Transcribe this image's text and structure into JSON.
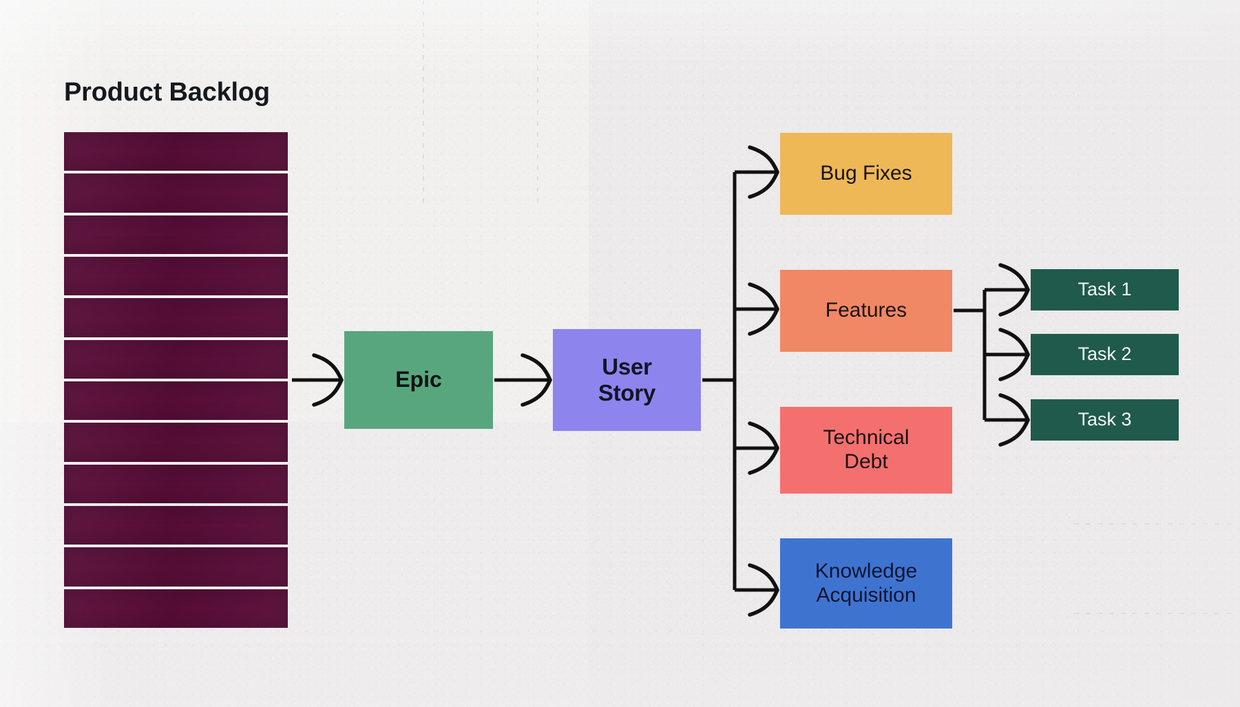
{
  "diagram": {
    "title": "Product Backlog",
    "backlog": {
      "label": "Product Backlog",
      "row_count": 12,
      "color": "#5E0F3C",
      "divider_color": "#ffffff"
    },
    "nodes": {
      "epic": {
        "label": "Epic",
        "color": "#58A67E",
        "text_color": "#101216"
      },
      "user_story": {
        "line1": "User",
        "line2": "Story",
        "color": "#8E84EE",
        "text_color": "#121524"
      },
      "bug_fixes": {
        "label": "Bug Fixes",
        "color": "#EEB857",
        "text_color": "#17140e"
      },
      "features": {
        "label": "Features",
        "color": "#F08765",
        "text_color": "#1a120d"
      },
      "technical_debt": {
        "line1": "Technical",
        "line2": "Debt",
        "color": "#F4706E",
        "text_color": "#1b1111"
      },
      "knowledge_acquisition": {
        "line1": "Knowledge",
        "line2": "Acquisition",
        "color": "#3E74D0",
        "text_color": "#0e1430"
      },
      "task_1": {
        "label": "Task 1",
        "color": "#1F5A4C",
        "text_color": "#f4f7f5"
      },
      "task_2": {
        "label": "Task 2",
        "color": "#1F5A4C",
        "text_color": "#f4f7f5"
      },
      "task_3": {
        "label": "Task 3",
        "color": "#1F5A4C",
        "text_color": "#f4f7f5"
      }
    },
    "connectors": {
      "arrow_color": "#111111",
      "flow": [
        {
          "from": "Product Backlog",
          "to": "Epic"
        },
        {
          "from": "Epic",
          "to": "User Story"
        },
        {
          "from": "User Story",
          "to": "Bug Fixes"
        },
        {
          "from": "User Story",
          "to": "Features"
        },
        {
          "from": "User Story",
          "to": "Technical Debt"
        },
        {
          "from": "User Story",
          "to": "Knowledge Acquisition"
        },
        {
          "from": "Features",
          "to": "Task 1"
        },
        {
          "from": "Features",
          "to": "Task 2"
        },
        {
          "from": "Features",
          "to": "Task 3"
        }
      ]
    },
    "background": {
      "base_color": "#f1f0ef",
      "panel_right_color": "#eceaea",
      "panel_bottom_left_color": "#eeecec"
    }
  }
}
